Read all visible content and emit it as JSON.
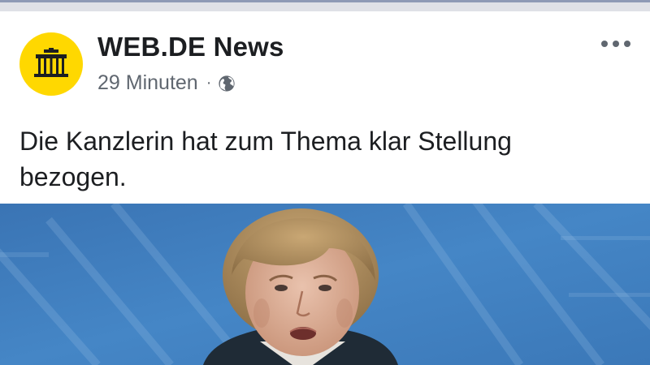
{
  "post": {
    "page_name": "WEB.DE News",
    "timestamp": "29 Minuten",
    "separator": "·",
    "audience_icon": "globe-icon",
    "more_icon": "more-options-icon",
    "text": "Die Kanzlerin hat zum Thema klar Stellung bezogen.",
    "image": "news-photo"
  },
  "colors": {
    "avatar_bg": "#ffd800",
    "name_text": "#1c1e21",
    "meta_text": "#606770",
    "photo_background": "#3f7fbd"
  }
}
